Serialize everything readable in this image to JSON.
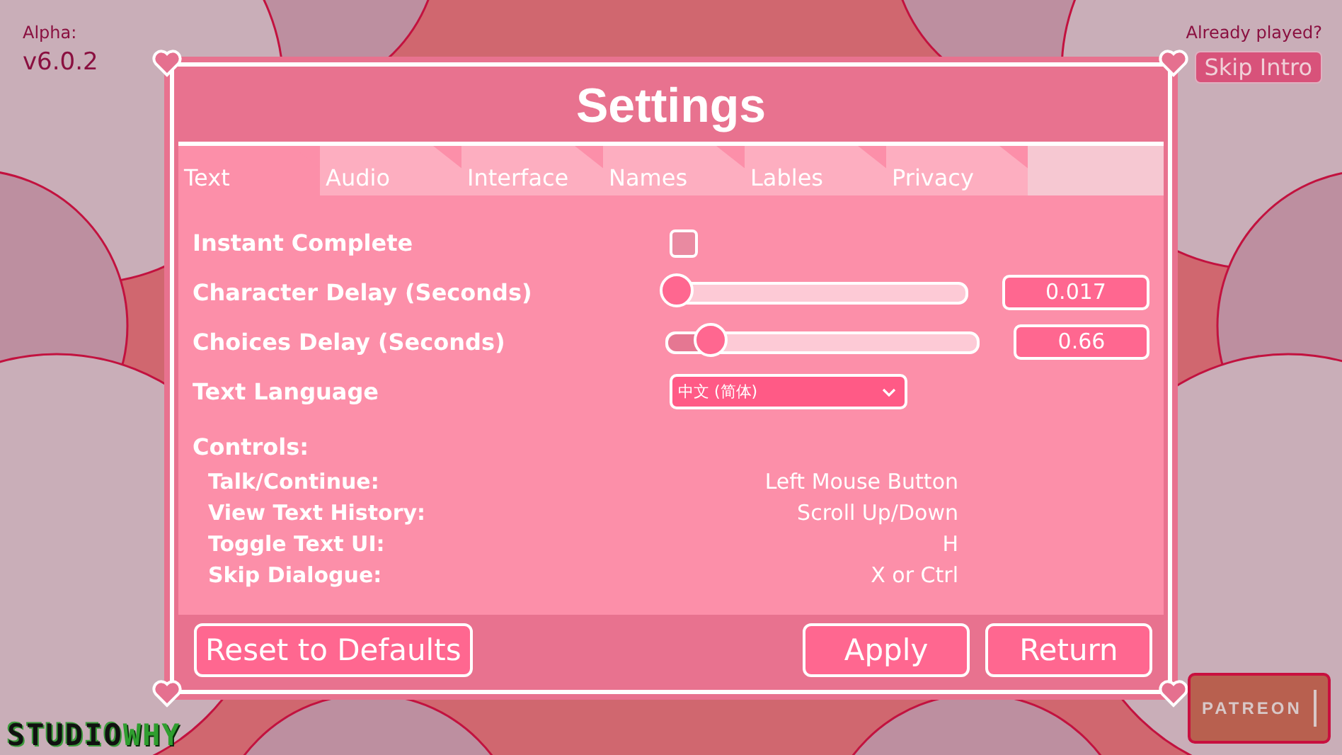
{
  "version": {
    "label": "Alpha:",
    "value": "v6.0.2"
  },
  "intro": {
    "question": "Already played?",
    "button": "Skip Intro"
  },
  "title": "Settings",
  "tabs": [
    {
      "label": "Text",
      "selected": true
    },
    {
      "label": "Audio",
      "selected": false
    },
    {
      "label": "Interface",
      "selected": false
    },
    {
      "label": "Names",
      "selected": false
    },
    {
      "label": "Lables",
      "selected": false
    },
    {
      "label": "Privacy",
      "selected": false
    }
  ],
  "settings": [
    {
      "kind": "checkbox",
      "label": "Instant Complete",
      "checked": false
    },
    {
      "kind": "slider",
      "label": "Character Delay (Seconds)",
      "level": 0.02,
      "value": "0.017"
    },
    {
      "kind": "slider",
      "label": "Choices Delay (Seconds)",
      "level": 0.13,
      "value": "0.66"
    },
    {
      "kind": "dropdown",
      "label": "Text Language",
      "value": "中文 (简体)"
    }
  ],
  "controls": {
    "heading": "Controls:",
    "items": [
      {
        "action": "Talk/Continue:",
        "key": "Left Mouse Button"
      },
      {
        "action": "View Text History:",
        "key": "Scroll Up/Down"
      },
      {
        "action": "Toggle Text UI:",
        "key": "H"
      },
      {
        "action": "Skip Dialogue:",
        "key": "X or Ctrl"
      }
    ]
  },
  "footer_buttons": [
    "Reset to Defaults",
    "Apply",
    "Return"
  ],
  "logo": {
    "part_1": "STUDIO",
    "part_2": "WHY"
  },
  "patreon": "PATREON"
}
